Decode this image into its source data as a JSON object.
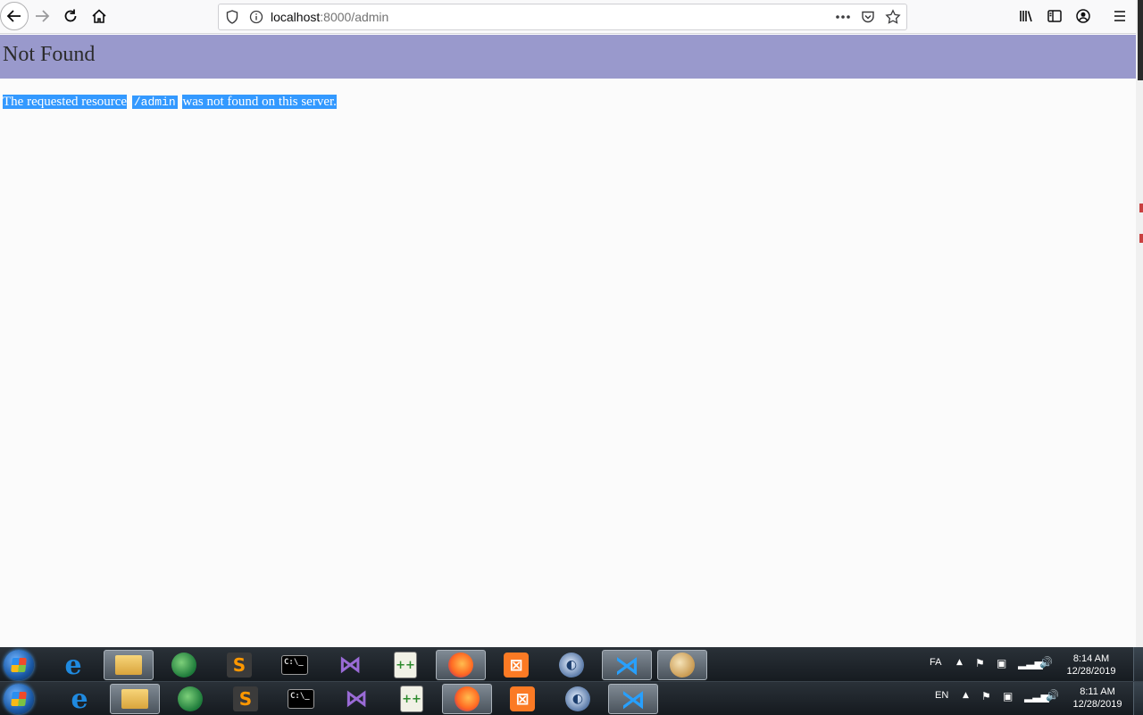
{
  "browser": {
    "url_host": "localhost",
    "url_rest": ":8000/admin"
  },
  "page": {
    "title": "Not Found",
    "message_before": "The requested resource",
    "message_code": "/admin",
    "message_after": "was not found on this server."
  },
  "taskbars": [
    {
      "lang": "FA",
      "time": "8:14 AM",
      "date": "12/28/2019"
    },
    {
      "lang": "EN",
      "time": "8:11 AM",
      "date": "12/28/2019"
    }
  ],
  "icons": {
    "back": "back-arrow-icon",
    "forward": "forward-arrow-icon",
    "reload": "reload-icon",
    "home": "home-icon",
    "shield": "shield-icon",
    "info": "info-icon",
    "more": "more-dots-icon",
    "pocket": "pocket-icon",
    "bookmark": "star-icon",
    "library": "library-icon",
    "sidebar": "sidebar-icon",
    "account": "account-icon",
    "menu": "hamburger-menu-icon"
  },
  "colors": {
    "header_band": "#9999cc",
    "selection": "#3399ff"
  }
}
